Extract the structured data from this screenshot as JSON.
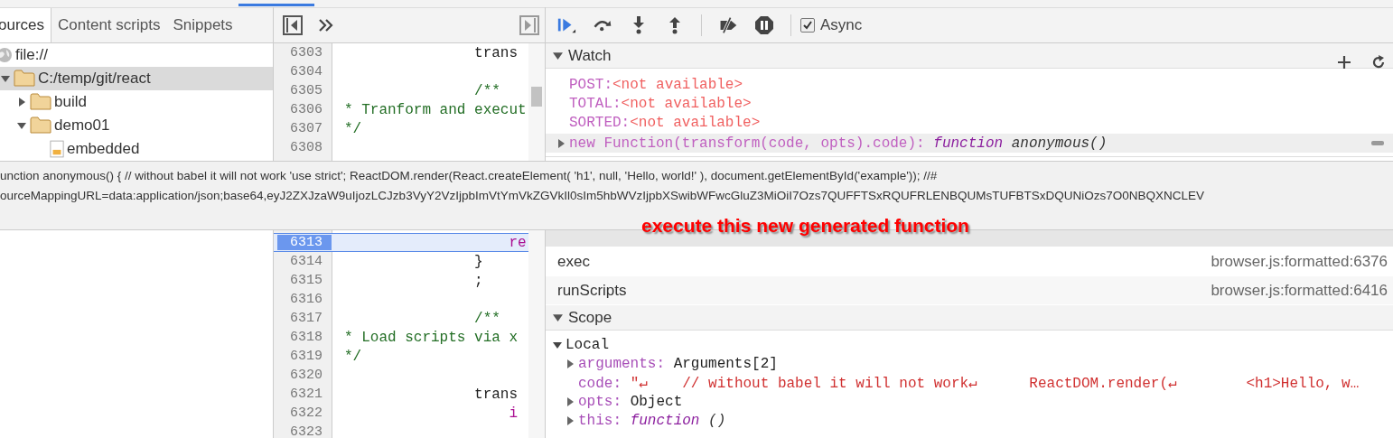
{
  "panel_tabs": [
    {
      "label": "ources",
      "selected": true
    },
    {
      "label": "Content scripts",
      "selected": false
    },
    {
      "label": "Snippets",
      "selected": false
    }
  ],
  "file_tree": [
    {
      "label": "file://",
      "kind": "origin",
      "children": [
        {
          "label": "C:/temp/git/react",
          "kind": "folder",
          "expanded": true,
          "selected": true,
          "children": [
            {
              "label": "build",
              "kind": "folder",
              "expanded": false,
              "selected": false
            },
            {
              "label": "demo01",
              "kind": "folder",
              "expanded": true,
              "selected": false,
              "children": [
                {
                  "label": "embedded",
                  "kind": "file",
                  "selected": false
                }
              ]
            }
          ]
        }
      ]
    }
  ],
  "code_top": [
    {
      "number": "6303",
      "text": "               trans",
      "kind": "plain",
      "current": false
    },
    {
      "number": "6304",
      "current": false
    },
    {
      "number": "6305",
      "text": "               /**",
      "kind": "comment",
      "current": false
    },
    {
      "number": "6306",
      "text": "* Tranform and execut",
      "kind": "comment",
      "current": false
    },
    {
      "number": "6307",
      "text": "*/",
      "kind": "comment",
      "current": false
    },
    {
      "number": "6308",
      "current": false
    }
  ],
  "code_bottom": [
    {
      "number": "6313",
      "text": "                   re",
      "kind": "keyword",
      "current": true
    },
    {
      "number": "6314",
      "text": "               }",
      "kind": "plain",
      "current": false
    },
    {
      "number": "6315",
      "text": "               ;",
      "kind": "plain",
      "current": false
    },
    {
      "number": "6316",
      "current": false
    },
    {
      "number": "6317",
      "text": "               /**",
      "kind": "comment",
      "current": false
    },
    {
      "number": "6318",
      "text": "* Load scripts via x",
      "kind": "comment",
      "current": false
    },
    {
      "number": "6319",
      "text": "*/",
      "kind": "comment",
      "current": false
    },
    {
      "number": "6320",
      "current": false
    },
    {
      "number": "6321",
      "text": "               trans",
      "kind": "plain",
      "current": false
    },
    {
      "number": "6322",
      "text": "                   i",
      "kind": "keyword",
      "current": false
    },
    {
      "number": "6323",
      "current": false
    }
  ],
  "async": {
    "label": "Async",
    "checked": true
  },
  "watch": {
    "title": "Watch",
    "expanded": true,
    "items": [
      {
        "kind": "unavailable",
        "name": "POST:",
        "value": "<not available>"
      },
      {
        "kind": "unavailable",
        "name": "TOTAL:",
        "value": "<not available>"
      },
      {
        "kind": "unavailable",
        "name": "SORTED:",
        "value": "<not available>"
      },
      {
        "kind": "function",
        "name": "new Function(transform(code, opts).code):",
        "type": "function",
        "value": "anonymous()",
        "expanded": false
      }
    ]
  },
  "call_stack": [
    {
      "function": "exec",
      "location": "browser.js:formatted:6376",
      "selected": false
    },
    {
      "function": "runScripts",
      "location": "browser.js:formatted:6416",
      "selected": false
    }
  ],
  "scope": {
    "title": "Scope",
    "expanded": true,
    "local": {
      "label": "Local",
      "expanded": true,
      "properties": [
        {
          "kind": "object",
          "name": "arguments:",
          "value": "Arguments[2]",
          "expanded": false
        },
        {
          "kind": "string",
          "name": "code:",
          "value": "\"↵    // without babel it will not work↵      ReactDOM.render(↵        <h1>Hello, w…"
        },
        {
          "kind": "object",
          "name": "opts:",
          "value": "Object",
          "expanded": false
        },
        {
          "kind": "function",
          "name": "this:",
          "type": "function",
          "value": "()",
          "expanded": false
        }
      ]
    }
  },
  "tooltip": {
    "lines": [
      "unction anonymous() { // without babel it will not work 'use strict'; ReactDOM.render(React.createElement( 'h1', null, 'Hello, world!' ), document.getElementById('example')); //#",
      "ourceMappingURL=data:application/json;base64,eyJ2ZXJzaW9uIjozLCJzb3VyY2VzIjpbImVtYmVkZGVkIl0sIm5hbWVzIjpbXSwibWFwcGluZ3MiOiI7Ozs7QUFFTSxRQUFRLENBQUMsTUFBTSxDQUNiOzs7O0NBQXNCLEV"
    ]
  },
  "annotation": "execute this new generated function"
}
